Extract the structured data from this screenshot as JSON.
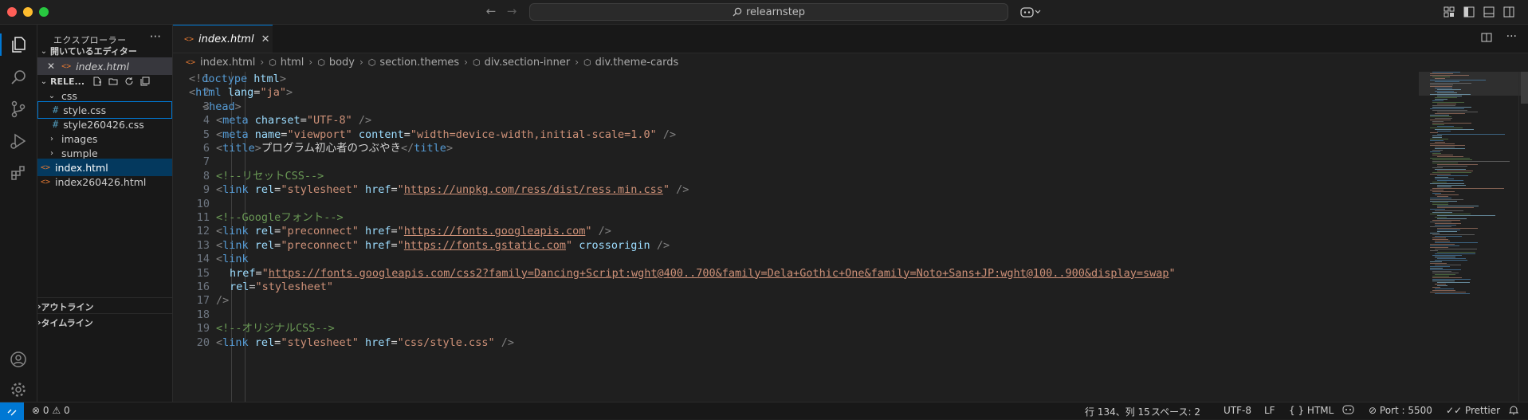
{
  "titlebar": {
    "search_text": "relearnstep"
  },
  "sidebar": {
    "title": "エクスプローラー",
    "more": "···",
    "open_editors": {
      "label": "開いているエディター",
      "files": [
        {
          "name": "index.html"
        }
      ]
    },
    "folder": {
      "label": "RELE...",
      "items": [
        {
          "name": "css",
          "kind": "folder-open"
        },
        {
          "name": "style.css",
          "kind": "css"
        },
        {
          "name": "style260426.css",
          "kind": "css"
        },
        {
          "name": "images",
          "kind": "folder"
        },
        {
          "name": "sumple",
          "kind": "folder"
        },
        {
          "name": "index.html",
          "kind": "html"
        },
        {
          "name": "index260426.html",
          "kind": "html"
        }
      ]
    },
    "outline": "アウトライン",
    "timeline": "タイムライン"
  },
  "tab": {
    "label": "index.html"
  },
  "breadcrumb": {
    "items": [
      "index.html",
      "html",
      "body",
      "section.themes",
      "div.section-inner",
      "div.theme-cards"
    ]
  },
  "code": {
    "lines": [
      {
        "n": "1",
        "indent": 0,
        "t": [
          [
            "p",
            "<!"
          ],
          [
            "k",
            "doctype "
          ],
          [
            "a",
            "html"
          ],
          [
            "p",
            ">"
          ]
        ]
      },
      {
        "n": "2",
        "indent": 0,
        "t": [
          [
            "p",
            "<"
          ],
          [
            "k",
            "html "
          ],
          [
            "a",
            "lang"
          ],
          [
            "x",
            "="
          ],
          [
            "s",
            "\"ja\""
          ],
          [
            "p",
            ">"
          ]
        ]
      },
      {
        "n": "3",
        "indent": 1,
        "t": [
          [
            "p",
            "<"
          ],
          [
            "k",
            "head"
          ],
          [
            "p",
            ">"
          ]
        ]
      },
      {
        "n": "4",
        "indent": 2,
        "t": [
          [
            "p",
            "<"
          ],
          [
            "k",
            "meta "
          ],
          [
            "a",
            "charset"
          ],
          [
            "x",
            "="
          ],
          [
            "s",
            "\"UTF-8\""
          ],
          [
            "p",
            " />"
          ]
        ]
      },
      {
        "n": "5",
        "indent": 2,
        "t": [
          [
            "p",
            "<"
          ],
          [
            "k",
            "meta "
          ],
          [
            "a",
            "name"
          ],
          [
            "x",
            "="
          ],
          [
            "s",
            "\"viewport\""
          ],
          [
            "x",
            " "
          ],
          [
            "a",
            "content"
          ],
          [
            "x",
            "="
          ],
          [
            "s",
            "\"width=device-width,initial-scale=1.0\""
          ],
          [
            "p",
            " />"
          ]
        ]
      },
      {
        "n": "6",
        "indent": 2,
        "t": [
          [
            "p",
            "<"
          ],
          [
            "k",
            "title"
          ],
          [
            "p",
            ">"
          ],
          [
            "x",
            "プログラム初心者のつぶやき"
          ],
          [
            "p",
            "</"
          ],
          [
            "k",
            "title"
          ],
          [
            "p",
            ">"
          ]
        ]
      },
      {
        "n": "7",
        "indent": 2,
        "t": []
      },
      {
        "n": "8",
        "indent": 2,
        "t": [
          [
            "c",
            "<!--リセットCSS-->"
          ]
        ]
      },
      {
        "n": "9",
        "indent": 2,
        "t": [
          [
            "p",
            "<"
          ],
          [
            "k",
            "link "
          ],
          [
            "a",
            "rel"
          ],
          [
            "x",
            "="
          ],
          [
            "s",
            "\"stylesheet\""
          ],
          [
            "x",
            " "
          ],
          [
            "a",
            "href"
          ],
          [
            "x",
            "="
          ],
          [
            "s",
            "\""
          ],
          [
            "u",
            "https://unpkg.com/ress/dist/ress.min.css"
          ],
          [
            "s",
            "\""
          ],
          [
            "p",
            " />"
          ]
        ]
      },
      {
        "n": "10",
        "indent": 2,
        "t": []
      },
      {
        "n": "11",
        "indent": 2,
        "t": [
          [
            "c",
            "<!--Googleフォント-->"
          ]
        ]
      },
      {
        "n": "12",
        "indent": 2,
        "t": [
          [
            "p",
            "<"
          ],
          [
            "k",
            "link "
          ],
          [
            "a",
            "rel"
          ],
          [
            "x",
            "="
          ],
          [
            "s",
            "\"preconnect\""
          ],
          [
            "x",
            " "
          ],
          [
            "a",
            "href"
          ],
          [
            "x",
            "="
          ],
          [
            "s",
            "\""
          ],
          [
            "u",
            "https://fonts.googleapis.com"
          ],
          [
            "s",
            "\""
          ],
          [
            "p",
            " />"
          ]
        ]
      },
      {
        "n": "13",
        "indent": 2,
        "t": [
          [
            "p",
            "<"
          ],
          [
            "k",
            "link "
          ],
          [
            "a",
            "rel"
          ],
          [
            "x",
            "="
          ],
          [
            "s",
            "\"preconnect\""
          ],
          [
            "x",
            " "
          ],
          [
            "a",
            "href"
          ],
          [
            "x",
            "="
          ],
          [
            "s",
            "\""
          ],
          [
            "u",
            "https://fonts.gstatic.com"
          ],
          [
            "s",
            "\""
          ],
          [
            "x",
            " "
          ],
          [
            "a",
            "crossorigin"
          ],
          [
            "p",
            " />"
          ]
        ]
      },
      {
        "n": "14",
        "indent": 2,
        "t": [
          [
            "p",
            "<"
          ],
          [
            "k",
            "link"
          ]
        ]
      },
      {
        "n": "15",
        "indent": 3,
        "t": [
          [
            "a",
            "href"
          ],
          [
            "x",
            "="
          ],
          [
            "s",
            "\""
          ],
          [
            "u",
            "https://fonts.googleapis.com/css2?family=Dancing+Script:wght@400..700&family=Dela+Gothic+One&family=Noto+Sans+JP:wght@100..900&display=swap"
          ],
          [
            "s",
            "\""
          ]
        ]
      },
      {
        "n": "16",
        "indent": 3,
        "t": [
          [
            "a",
            "rel"
          ],
          [
            "x",
            "="
          ],
          [
            "s",
            "\"stylesheet\""
          ]
        ]
      },
      {
        "n": "17",
        "indent": 2,
        "t": [
          [
            "p",
            "/>"
          ]
        ]
      },
      {
        "n": "18",
        "indent": 2,
        "t": []
      },
      {
        "n": "19",
        "indent": 2,
        "t": [
          [
            "c",
            "<!--オリジナルCSS-->"
          ]
        ]
      },
      {
        "n": "20",
        "indent": 2,
        "t": [
          [
            "p",
            "<"
          ],
          [
            "k",
            "link "
          ],
          [
            "a",
            "rel"
          ],
          [
            "x",
            "="
          ],
          [
            "s",
            "\"stylesheet\""
          ],
          [
            "x",
            " "
          ],
          [
            "a",
            "href"
          ],
          [
            "x",
            "="
          ],
          [
            "s",
            "\"css/style.css\""
          ],
          [
            "p",
            " />"
          ]
        ]
      }
    ]
  },
  "status": {
    "errors": "0",
    "warnings": "0",
    "cursor": "行 134、列 15",
    "spaces": "スペース: 2",
    "encoding": "UTF-8",
    "eol": "LF",
    "language_braces": "{ }",
    "language": "HTML",
    "port": "Port : 5500",
    "prettier": "Prettier"
  },
  "colors": {
    "accent": "#0078d4",
    "tag": "#569cd6",
    "attr": "#9cdcfe",
    "string": "#ce9178",
    "comment": "#6a9955"
  },
  "icons": [
    "explorer-icon",
    "search-icon",
    "source-control-icon",
    "run-debug-icon",
    "extensions-icon",
    "account-icon",
    "settings-gear-icon",
    "copilot-icon",
    "toggle-panel-icon",
    "split-editor-icon",
    "bell-icon"
  ]
}
